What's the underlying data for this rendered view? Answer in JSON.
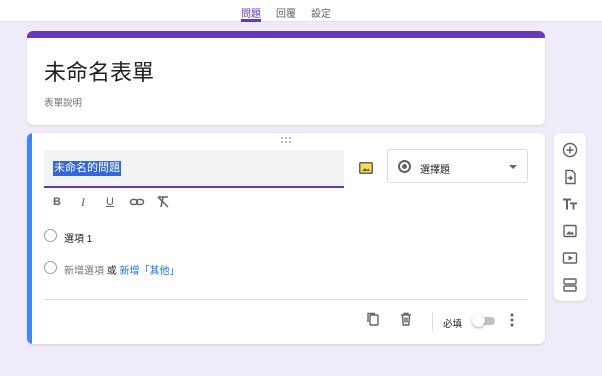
{
  "tabs": [
    {
      "label": "問題",
      "active": true
    },
    {
      "label": "回覆",
      "active": false
    },
    {
      "label": "設定",
      "active": false
    }
  ],
  "form": {
    "title": "未命名表單",
    "description": "表單說明"
  },
  "question": {
    "title": "未命名的問題",
    "type": "選擇題",
    "options": [
      "選項 1"
    ],
    "add_option": "新增選項",
    "or": "或",
    "add_other": "新增「其他」",
    "required_label": "必填",
    "required": false
  },
  "icons": {
    "format": [
      "bold-icon",
      "italic-icon",
      "underline-icon",
      "link-icon",
      "clear-format-icon"
    ],
    "side": [
      "add-question-icon",
      "import-questions-icon",
      "add-title-icon",
      "add-image-icon",
      "add-video-icon",
      "add-section-icon"
    ]
  },
  "colors": {
    "accent": "#673ab7",
    "focus": "#4285f4",
    "link": "#1a73e8",
    "background": "#efebf8"
  }
}
